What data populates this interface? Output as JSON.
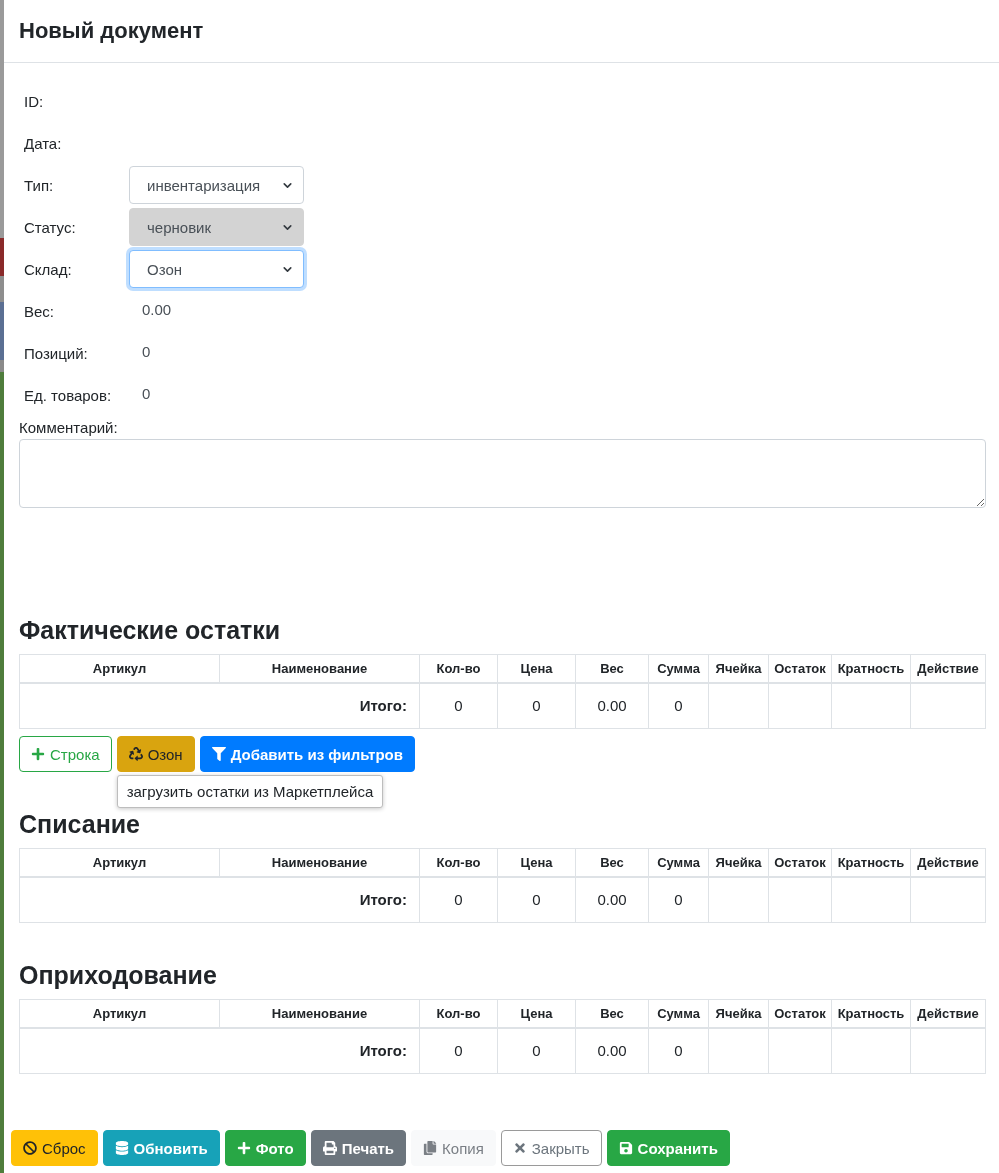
{
  "window": {
    "title": "Новый документ"
  },
  "fields": [
    {
      "kind": "text",
      "label": "ID:"
    },
    {
      "kind": "text",
      "label": "Дата:"
    },
    {
      "kind": "select",
      "label": "Тип:",
      "value": "инвентаризация",
      "disabled": false,
      "focused": false
    },
    {
      "kind": "select",
      "label": "Статус:",
      "value": "черновик",
      "disabled": true,
      "focused": false
    },
    {
      "kind": "select",
      "label": "Склад:",
      "value": "Озон",
      "disabled": false,
      "focused": true
    },
    {
      "kind": "text",
      "label": "Вес:",
      "value": "0.00"
    },
    {
      "kind": "text",
      "label": "Позиций:",
      "value": "0"
    },
    {
      "kind": "text",
      "label": "Ед. товаров:",
      "value": "0"
    }
  ],
  "comment": {
    "label": "Комментарий:"
  },
  "sections": [
    {
      "title": "Фактические остатки",
      "table": {
        "columns": [
          "Артикул",
          "Наименование",
          "Кол-во",
          "Цена",
          "Вес",
          "Сумма",
          "Ячейка",
          "Остаток",
          "Кратность",
          "Действие"
        ],
        "total_label": "Итого:",
        "totals": [
          "0",
          "0",
          "0.00",
          "0"
        ]
      },
      "buttons": [
        {
          "kind": "add",
          "label": "Строка"
        },
        {
          "kind": "marketplace",
          "label": "Озон",
          "tooltip": "загрузить остатки из Маркетплейса"
        },
        {
          "kind": "filter",
          "label": "Добавить из фильтров"
        }
      ]
    },
    {
      "title": "Списание",
      "table": {
        "columns": [
          "Артикул",
          "Наименование",
          "Кол-во",
          "Цена",
          "Вес",
          "Сумма",
          "Ячейка",
          "Остаток",
          "Кратность",
          "Действие"
        ],
        "total_label": "Итого:",
        "totals": [
          "0",
          "0",
          "0.00",
          "0"
        ]
      }
    },
    {
      "title": "Оприходование",
      "table": {
        "columns": [
          "Артикул",
          "Наименование",
          "Кол-во",
          "Цена",
          "Вес",
          "Сумма",
          "Ячейка",
          "Остаток",
          "Кратность",
          "Действие"
        ],
        "total_label": "Итого:",
        "totals": [
          "0",
          "0",
          "0.00",
          "0"
        ]
      }
    }
  ],
  "footer_buttons": [
    {
      "kind": "reset",
      "label": "Сброс"
    },
    {
      "kind": "refresh",
      "label": "Обновить"
    },
    {
      "kind": "photo",
      "label": "Фото"
    },
    {
      "kind": "print",
      "label": "Печать"
    },
    {
      "kind": "copy",
      "label": "Копия"
    },
    {
      "kind": "close",
      "label": "Закрыть"
    },
    {
      "kind": "save",
      "label": "Сохранить"
    }
  ]
}
